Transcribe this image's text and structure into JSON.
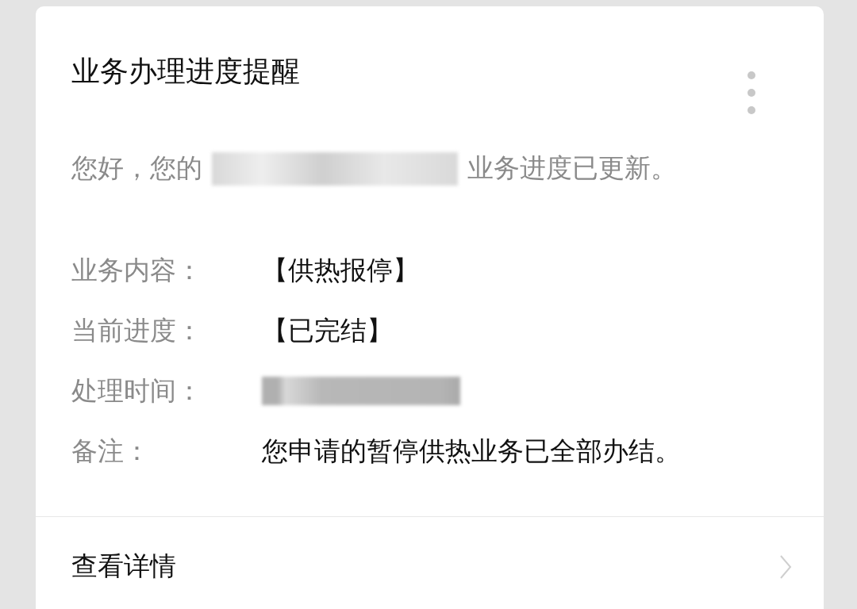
{
  "card": {
    "title": "业务办理进度提醒",
    "greeting": {
      "before": "您好，您的",
      "redacted": true,
      "after": "业务进度已更新。"
    },
    "fields": [
      {
        "label": "业务内容：",
        "kind": "text",
        "value": "【供热报停】"
      },
      {
        "label": "当前进度：",
        "kind": "text",
        "value": "【已完结】"
      },
      {
        "label": "处理时间：",
        "kind": "redacted"
      },
      {
        "label": "备注：",
        "kind": "text",
        "value": "您申请的暂停供热业务已全部办结。"
      }
    ],
    "footer": {
      "link": "查看详情"
    }
  }
}
